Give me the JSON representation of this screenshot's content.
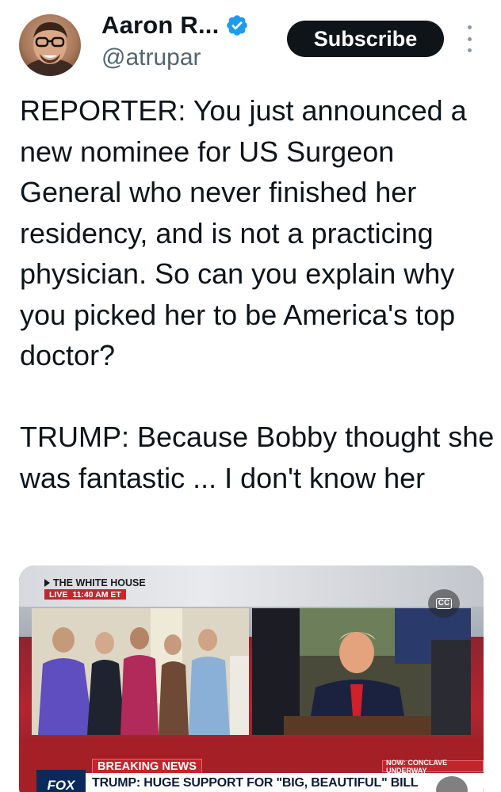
{
  "author": {
    "display_name": "Aaron R...",
    "handle": "@atrupar",
    "verified": true,
    "avatar_icon": "person-avatar"
  },
  "actions": {
    "subscribe_label": "Subscribe",
    "more_icon": "more-vertical-icon"
  },
  "tweet": {
    "paragraphs": [
      "REPORTER: You just announced a new nominee for US Surgeon General who never finished her residency, and is not a practicing physician. So can you explain why you picked her to be America's top doctor?",
      "TRUMP: Because Bobby thought she was fantastic ... I don't know her"
    ]
  },
  "media": {
    "location_label": "THE WHITE HOUSE",
    "live_label": "LIVE",
    "live_time": "11:40 AM ET",
    "cc_label": "CC",
    "breaking_label_1": "BREAKING",
    "breaking_label_2": "NEWS",
    "now_label": "NOW: CONCLAVE UNDERWAY",
    "network_logo": "FOX",
    "headline": "TRUMP: HUGE SUPPORT FOR \"BIG, BEAUTIFUL\" BILL",
    "mute_icon": "volume-icon"
  },
  "colors": {
    "verified_blue": "#1d9bf0",
    "subscribe_bg": "#0f1419",
    "handle_gray": "#536471",
    "breaking_red": "#c4242c"
  }
}
